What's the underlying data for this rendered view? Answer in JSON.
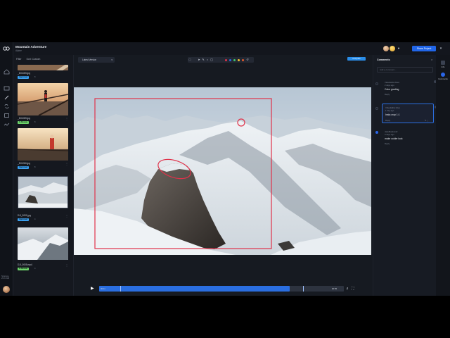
{
  "header": {
    "project_title": "Mountain Adventure",
    "project_subtitle": "Alpine",
    "share_label": "Share Project",
    "colors": {
      "accent": "#2166e8"
    }
  },
  "sidebar": {
    "storage_label": "Storage",
    "storage_value": "25.6 GB"
  },
  "files": {
    "tabs": [
      "Filter",
      "Sort: Custom"
    ],
    "items": [
      {
        "name": "_D01005.jpg",
        "tag": "Approved",
        "tag_color": "#3aa0f0",
        "meta": "8"
      },
      {
        "name": "_D01005.jpg",
        "tag": "In Review",
        "tag_color": "#6dd46b",
        "meta": "8"
      },
      {
        "name": "_D01006.jpg",
        "tag": "Approved",
        "tag_color": "#3aa0f0",
        "meta": "8"
      },
      {
        "name": "DJI_0001.jpg",
        "tag": "Approved",
        "tag_color": "#3aa0f0",
        "meta": "4"
      },
      {
        "name": "DJI_0005.mp4",
        "tag": "In Review",
        "tag_color": "#6dd46b",
        "meta": "4"
      }
    ]
  },
  "viewer": {
    "version_label": "Latest Version",
    "compare_label": "Compare",
    "timecode_start": "00:11",
    "timecode_end": "00:55",
    "progress": 0.78
  },
  "comments": {
    "title": "Comments",
    "search_placeholder": "Add a comment...",
    "reply_label": "Reply",
    "items": [
      {
        "user": "VideoEditorJules",
        "time": "2 days ago",
        "text": "Color grading"
      },
      {
        "user": "VideoEditorJules",
        "time": "1 day ago",
        "text": "Insta crop 1:1"
      },
      {
        "user": "JakeMarkowitz",
        "time": "3 days ago",
        "text": "make colder look"
      }
    ]
  },
  "right_rail": {
    "items": [
      "Info",
      "Comments"
    ]
  }
}
